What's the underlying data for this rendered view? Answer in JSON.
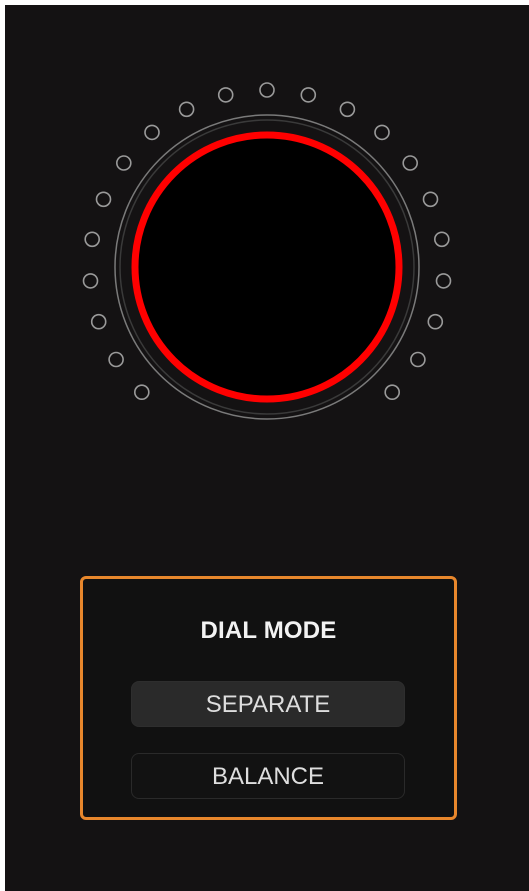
{
  "dial": {
    "ring_color": "#ff0000",
    "led_color": "#9a9a9a",
    "led_count": 21
  },
  "dial_mode": {
    "title": "DIAL MODE",
    "options": [
      {
        "label": "SEPARATE",
        "selected": true
      },
      {
        "label": "BALANCE",
        "selected": false
      }
    ],
    "highlight_color": "#e8872c"
  }
}
